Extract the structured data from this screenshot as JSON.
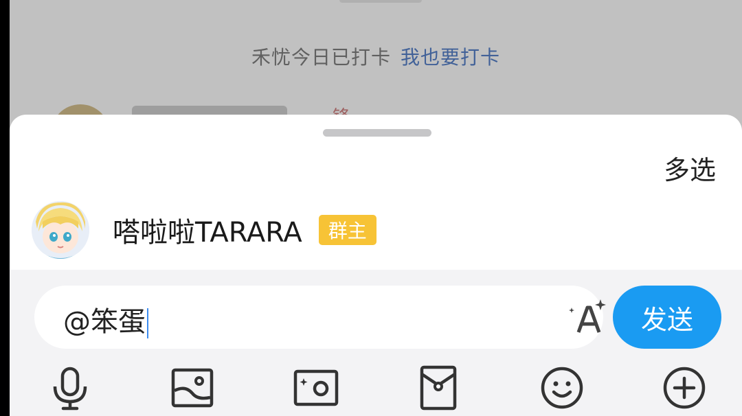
{
  "background_chat": {
    "checkin_text": "禾忧今日已打卡",
    "checkin_link": "我也要打卡",
    "partial_name": "锋"
  },
  "sheet": {
    "multi_select_label": "多选",
    "members": [
      {
        "name": "嗒啦啦TARARA",
        "badge": "群主"
      }
    ]
  },
  "input": {
    "value": "@笨蛋",
    "send_label": "发送"
  },
  "toolbar": {
    "icons": [
      "microphone-icon",
      "image-icon",
      "camera-icon",
      "red-packet-icon",
      "emoji-icon",
      "plus-icon"
    ]
  },
  "colors": {
    "accent": "#1a9bf2",
    "owner_badge": "#f7c336",
    "link": "#4a6fae"
  }
}
